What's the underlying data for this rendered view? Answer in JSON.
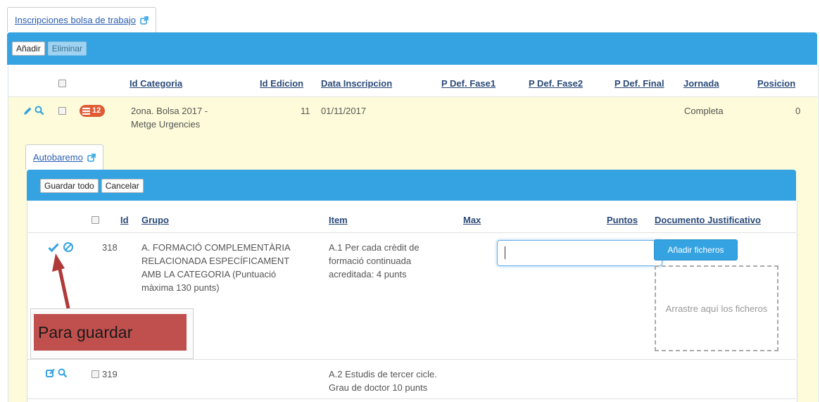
{
  "outer_tab": {
    "label": "Inscripciones bolsa de trabajo"
  },
  "outer_toolbar": {
    "add_label": "Añadir",
    "delete_label": "Eliminar"
  },
  "outer_table": {
    "headers": {
      "id_categoria": "Id Categoria",
      "id_edicion": "Id Edicion",
      "data_inscripcion": "Data Inscripcion",
      "p_def_fase1": "P Def. Fase1",
      "p_def_fase2": "P Def. Fase2",
      "p_def_final": "P Def. Final",
      "jornada": "Jornada",
      "posicion": "Posicion"
    },
    "row": {
      "badge_count": "12",
      "categoria_line1": "2ona. Bolsa 2017 -",
      "categoria_line2": "Metge Urgencies",
      "edicion": "11",
      "data": "01/11/2017",
      "jornada": "Completa",
      "posicion": "0"
    }
  },
  "inner_tab": {
    "label": "Autobaremo"
  },
  "inner_toolbar": {
    "save_all_label": "Guardar todo",
    "cancel_label": "Cancelar"
  },
  "inner_table": {
    "headers": {
      "id": "Id",
      "grupo": "Grupo",
      "item": "Item",
      "max": "Max",
      "puntos": "Puntos",
      "documento": "Documento Justificativo"
    },
    "rows": [
      {
        "id": "318",
        "grupo": [
          "A. FORMACIÓ COMPLEMENTÀRIA",
          "RELACIONADA ESPECÍFICAMENT",
          "AMB LA CATEGORIA (Puntuació",
          "màxima 130 punts)"
        ],
        "item": [
          "A.1 Per cada crèdit de",
          "formació continuada",
          "acreditada: 4 punts"
        ],
        "puntos_value": ""
      },
      {
        "id": "319",
        "item": [
          "A.2 Estudis de tercer cicle.",
          "Grau de doctor 10 punts"
        ]
      }
    ],
    "add_files_label": "Añadir ficheros",
    "dropzone_text": "Arrastre aquí los ficheros"
  },
  "annotation": {
    "text": "Para guardar",
    "color": "#c0504d"
  },
  "colors": {
    "toolbar": "#35a3e2",
    "highlight_row": "#fdfbd9",
    "link": "#2a4a78",
    "badge": "#e05a33"
  }
}
